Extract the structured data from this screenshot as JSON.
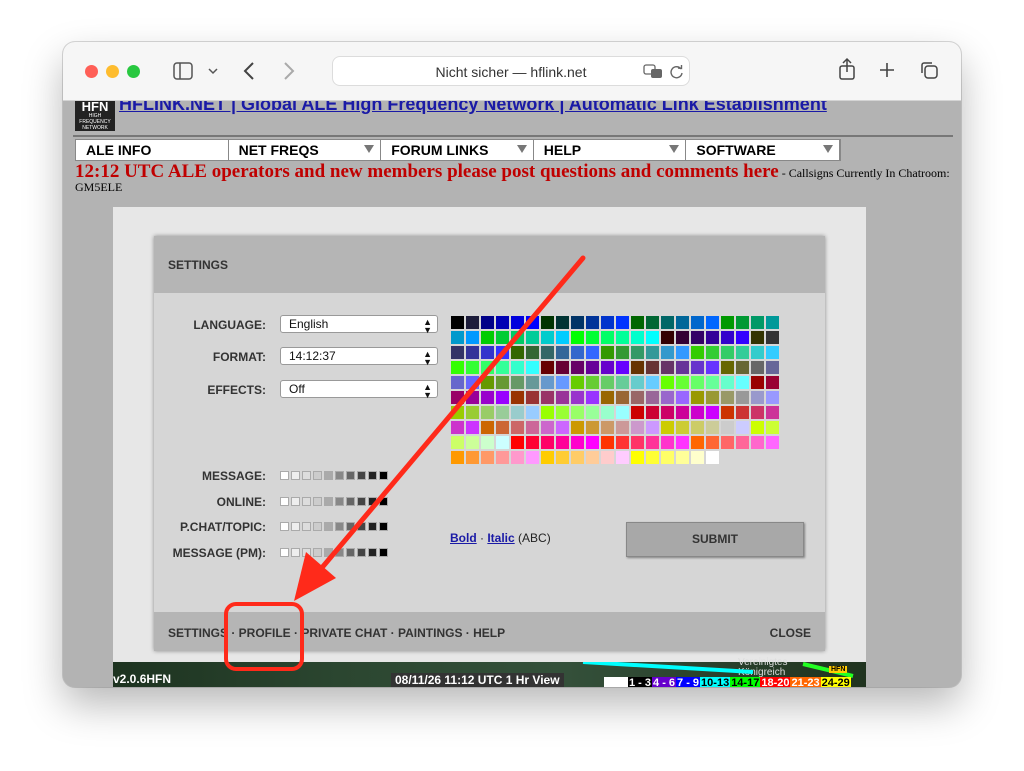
{
  "browser": {
    "url_text": "Nicht sicher — hflink.net",
    "traffic_lights": [
      "#ff5f57",
      "#febc2e",
      "#28c840"
    ],
    "icons": [
      "sidebar-icon",
      "chevron-down-icon",
      "back-icon",
      "forward-icon",
      "translate-icon",
      "reload-icon",
      "share-icon",
      "new-tab-icon",
      "tabs-overview-icon"
    ]
  },
  "site": {
    "logo_big": "HFN",
    "logo_small": [
      "HIGH",
      "FREQUENCY",
      "NETWORK"
    ],
    "title": "HFLINK.NET | Global ALE High Frequency Network | Automatic Link Establishment",
    "menu": [
      "ALE INFO",
      "NET FREQS",
      "FORUM LINKS",
      "HELP",
      "SOFTWARE"
    ],
    "announcement_big": "12:12 UTC ALE operators and new members please post questions and comments here",
    "announcement_small": " - Callsigns Currently In Chatroom: GM5ELE"
  },
  "settings": {
    "title": "SETTINGS",
    "language_label": "LANGUAGE:",
    "language_value": "English",
    "format_label": "FORMAT:",
    "format_value": "14:12:37",
    "effects_label": "EFFECTS:",
    "effects_value": "Off",
    "message_label": "MESSAGE:",
    "online_label": "ONLINE:",
    "pchat_label": "P.CHAT/TOPIC:",
    "pm_label": "MESSAGE (PM):",
    "bold_label": "Bold",
    "separator": " · ",
    "italic_label": "Italic",
    "abc_label": " (ABC)",
    "submit_label": "SUBMIT",
    "footer_links": "SETTINGS · PROFILE · PRIVATE CHAT · PAINTINGS · HELP",
    "close_label": "CLOSE"
  },
  "palette": [
    "#000000",
    "#1c1c3a",
    "#000088",
    "#0000b4",
    "#0000dd",
    "#0000ff",
    "#003300",
    "#003333",
    "#003366",
    "#003399",
    "#0033cc",
    "#0033ff",
    "#006600",
    "#006633",
    "#006666",
    "#006699",
    "#0066cc",
    "#0066ff",
    "#009900",
    "#009933",
    "#009966",
    "#009999",
    "#0099cc",
    "#0099ff",
    "#00cc00",
    "#00cc33",
    "#00cc66",
    "#00cc99",
    "#00cccc",
    "#00ccff",
    "#00ff00",
    "#00ff33",
    "#00ff66",
    "#00ff99",
    "#00ffcc",
    "#00ffff",
    "#330000",
    "#330033",
    "#330066",
    "#330099",
    "#3300cc",
    "#3300ff",
    "#333300",
    "#333333",
    "#333366",
    "#333399",
    "#3333cc",
    "#3333ff",
    "#336600",
    "#336633",
    "#336666",
    "#336699",
    "#3366cc",
    "#3366ff",
    "#339900",
    "#339933",
    "#339966",
    "#339999",
    "#3399cc",
    "#3399ff",
    "#33cc00",
    "#33cc33",
    "#33cc66",
    "#33cc99",
    "#33cccc",
    "#33ccff",
    "#33ff00",
    "#33ff33",
    "#33ff66",
    "#33ff99",
    "#33ffcc",
    "#33ffff",
    "#660000",
    "#660033",
    "#660066",
    "#660099",
    "#6600cc",
    "#6600ff",
    "#663300",
    "#663333",
    "#663366",
    "#663399",
    "#6633cc",
    "#6633ff",
    "#666600",
    "#666633",
    "#666666",
    "#666699",
    "#6666cc",
    "#6666ff",
    "#669900",
    "#669933",
    "#669966",
    "#669999",
    "#6699cc",
    "#6699ff",
    "#66cc00",
    "#66cc33",
    "#66cc66",
    "#66cc99",
    "#66cccc",
    "#66ccff",
    "#66ff00",
    "#66ff33",
    "#66ff66",
    "#66ff99",
    "#66ffcc",
    "#66ffff",
    "#990000",
    "#990033",
    "#990066",
    "#990099",
    "#9900cc",
    "#9900ff",
    "#993300",
    "#993333",
    "#993366",
    "#993399",
    "#9933cc",
    "#9933ff",
    "#996600",
    "#996633",
    "#996666",
    "#996699",
    "#9966cc",
    "#9966ff",
    "#999900",
    "#999933",
    "#999966",
    "#999999",
    "#9999cc",
    "#9999ff",
    "#99cc00",
    "#99cc33",
    "#99cc66",
    "#99cc99",
    "#99cccc",
    "#99ccff",
    "#99ff00",
    "#99ff33",
    "#99ff66",
    "#99ff99",
    "#99ffcc",
    "#99ffff",
    "#cc0000",
    "#cc0033",
    "#cc0066",
    "#cc0099",
    "#cc00cc",
    "#cc00ff",
    "#cc3300",
    "#cc3333",
    "#cc3366",
    "#cc3399",
    "#cc33cc",
    "#cc33ff",
    "#cc6600",
    "#cc6633",
    "#cc6666",
    "#cc6699",
    "#cc66cc",
    "#cc66ff",
    "#cc9900",
    "#cc9933",
    "#cc9966",
    "#cc9999",
    "#cc99cc",
    "#cc99ff",
    "#cccc00",
    "#cccc33",
    "#cccc66",
    "#cccc99",
    "#cccccc",
    "#ccccff",
    "#ccff00",
    "#ccff33",
    "#ccff66",
    "#ccff99",
    "#ccffcc",
    "#ccffff",
    "#ff0000",
    "#ff0033",
    "#ff0066",
    "#ff0099",
    "#ff00cc",
    "#ff00ff",
    "#ff3300",
    "#ff3333",
    "#ff3366",
    "#ff3399",
    "#ff33cc",
    "#ff33ff",
    "#ff6600",
    "#ff6633",
    "#ff6666",
    "#ff6699",
    "#ff66cc",
    "#ff66ff",
    "#ff9900",
    "#ff9933",
    "#ff9966",
    "#ff9999",
    "#ff99cc",
    "#ff99ff",
    "#ffcc00",
    "#ffcc33",
    "#ffcc66",
    "#ffcc99",
    "#ffcccc",
    "#ffccff",
    "#ffff00",
    "#ffff33",
    "#ffff66",
    "#ffff99",
    "#ffffcc",
    "#ffffff"
  ],
  "shades": [
    "#ffffff",
    "#eeeeee",
    "#dddddd",
    "#cccccc",
    "#aaaaaa",
    "#888888",
    "#666666",
    "#444444",
    "#222222",
    "#000000"
  ],
  "bottom_strip": {
    "version": "v2.0.6HFN",
    "timestamp": "08/11/26 11:12 UTC  1 Hr View",
    "map_label": "Vereinigtes Königreich",
    "legend": [
      {
        "text": "1 - 3",
        "bg": "#000000",
        "fg": "#ffffff"
      },
      {
        "text": "4 - 6",
        "bg": "#6600cc",
        "fg": "#ffffff"
      },
      {
        "text": "7 - 9",
        "bg": "#0000ff",
        "fg": "#ffffff"
      },
      {
        "text": "10-13",
        "bg": "#00ffff",
        "fg": "#000000"
      },
      {
        "text": "14-17",
        "bg": "#00ff00",
        "fg": "#000000"
      },
      {
        "text": "18-20",
        "bg": "#ff0000",
        "fg": "#ffffff"
      },
      {
        "text": "21-23",
        "bg": "#ff6600",
        "fg": "#ffffff"
      },
      {
        "text": "24-29",
        "bg": "#ffff00",
        "fg": "#000000"
      }
    ]
  },
  "annotation": {
    "arrow_color": "#ff2a1a"
  }
}
